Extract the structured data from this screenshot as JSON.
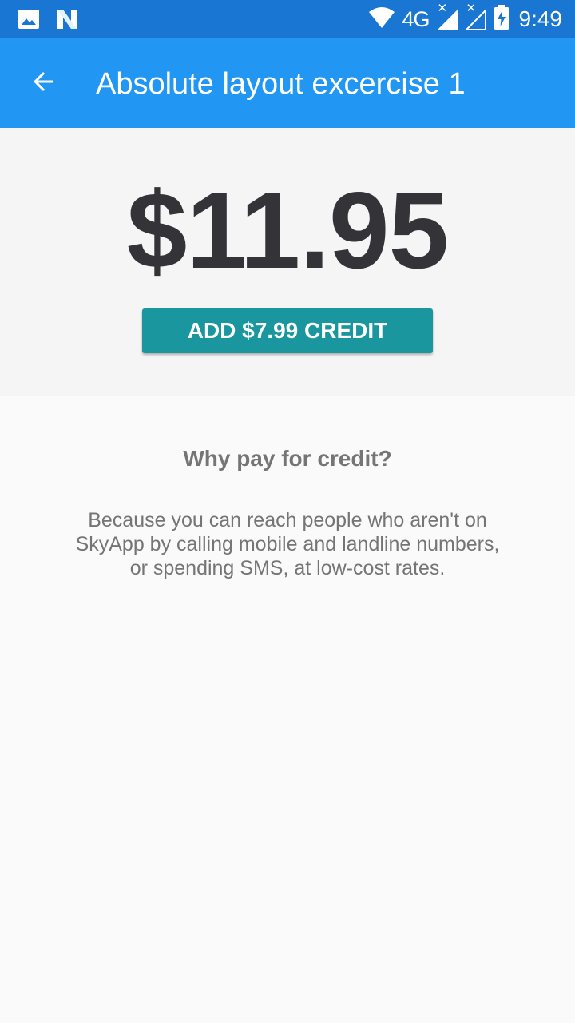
{
  "status_bar": {
    "network_label": "4G",
    "time": "9:49",
    "icons": [
      "image-icon",
      "n-icon",
      "wifi-icon",
      "signal-icon",
      "signal-no-sim-icon",
      "battery-charging-icon"
    ]
  },
  "app_bar": {
    "title": "Absolute layout excercise 1",
    "back_icon": "arrow-back-icon"
  },
  "balance": {
    "amount": "$11.95",
    "add_credit_label": "ADD $7.99 CREDIT"
  },
  "info": {
    "heading": "Why pay for credit?",
    "body": "Because you can reach people who aren't on SkyApp by calling mobile and landline numbers, or spending SMS, at low-cost rates."
  },
  "colors": {
    "status_bar": "#1976d2",
    "app_bar": "#2196f3",
    "button": "#1a979e",
    "price_text": "#333338",
    "secondary_text": "#757575",
    "panel_background": "#f5f5f5",
    "page_background": "#fafafa"
  }
}
